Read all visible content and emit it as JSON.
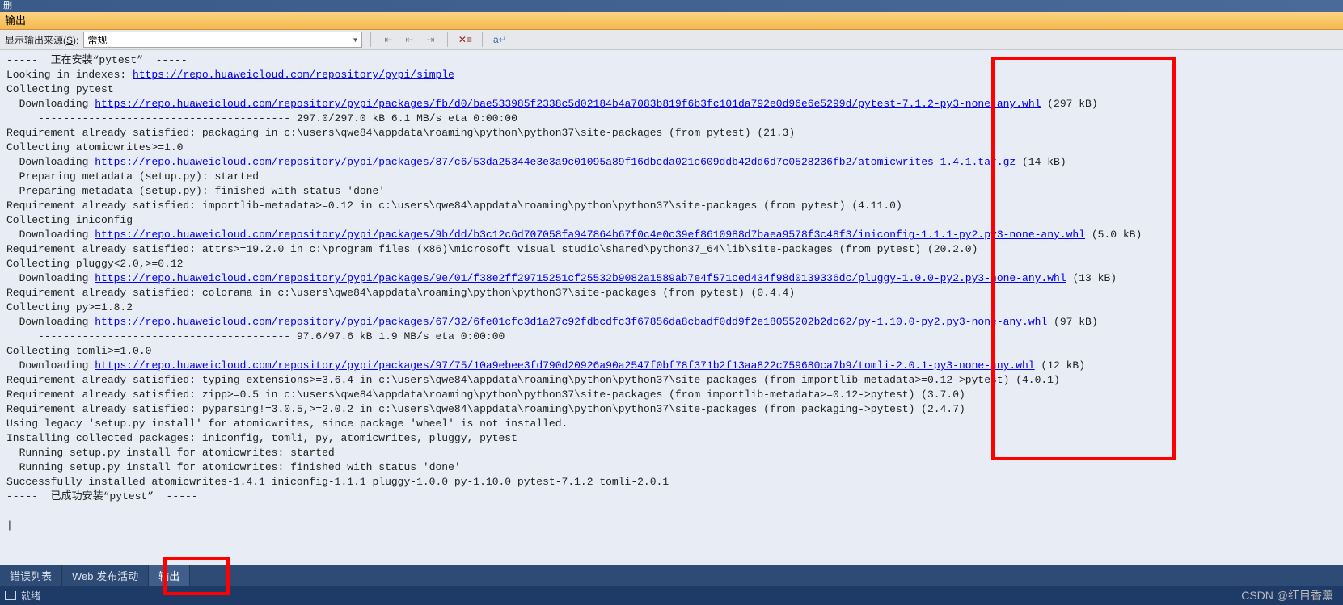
{
  "title_bar": "删",
  "panel_title": "输出",
  "toolbar": {
    "source_label_prefix": "显示输出来源(",
    "source_label_accel": "S",
    "source_label_suffix": "):",
    "source_value": "常规"
  },
  "bottom_tabs": {
    "error_list": "错误列表",
    "web_publish": "Web 发布活动",
    "output": "输出"
  },
  "status_bar": {
    "text": "就绪"
  },
  "watermark": "CSDN @红目香薰",
  "lines": [
    {
      "indent": 0,
      "parts": [
        {
          "t": "text",
          "v": "-----  正在安装“pytest”  -----"
        }
      ]
    },
    {
      "indent": 0,
      "parts": [
        {
          "t": "text",
          "v": "Looking in indexes: "
        },
        {
          "t": "link",
          "v": "https://repo.huaweicloud.com/repository/pypi/simple"
        }
      ]
    },
    {
      "indent": 0,
      "parts": [
        {
          "t": "text",
          "v": "Collecting pytest"
        }
      ]
    },
    {
      "indent": 1,
      "parts": [
        {
          "t": "text",
          "v": "Downloading "
        },
        {
          "t": "link",
          "v": "https://repo.huaweicloud.com/repository/pypi/packages/fb/d0/bae533985f2338c5d02184b4a7083b819f6b3fc101da792e0d96e6e5299d/pytest-7.1.2-py3-none-any.whl"
        },
        {
          "t": "text",
          "v": " (297 kB)"
        }
      ]
    },
    {
      "indent": 2,
      "parts": [
        {
          "t": "text",
          "v": "---------------------------------------- 297.0/297.0 kB 6.1 MB/s eta 0:00:00"
        }
      ]
    },
    {
      "indent": 0,
      "parts": [
        {
          "t": "text",
          "v": "Requirement already satisfied: packaging in c:\\users\\qwe84\\appdata\\roaming\\python\\python37\\site-packages (from pytest) (21.3)"
        }
      ]
    },
    {
      "indent": 0,
      "parts": [
        {
          "t": "text",
          "v": "Collecting atomicwrites>=1.0"
        }
      ]
    },
    {
      "indent": 1,
      "parts": [
        {
          "t": "text",
          "v": "Downloading "
        },
        {
          "t": "link",
          "v": "https://repo.huaweicloud.com/repository/pypi/packages/87/c6/53da25344e3e3a9c01095a89f16dbcda021c609ddb42dd6d7c0528236fb2/atomicwrites-1.4.1.tar.gz"
        },
        {
          "t": "text",
          "v": " (14 kB)"
        }
      ]
    },
    {
      "indent": 1,
      "parts": [
        {
          "t": "text",
          "v": "Preparing metadata (setup.py): started"
        }
      ]
    },
    {
      "indent": 1,
      "parts": [
        {
          "t": "text",
          "v": "Preparing metadata (setup.py): finished with status 'done'"
        }
      ]
    },
    {
      "indent": 0,
      "parts": [
        {
          "t": "text",
          "v": "Requirement already satisfied: importlib-metadata>=0.12 in c:\\users\\qwe84\\appdata\\roaming\\python\\python37\\site-packages (from pytest) (4.11.0)"
        }
      ]
    },
    {
      "indent": 0,
      "parts": [
        {
          "t": "text",
          "v": "Collecting iniconfig"
        }
      ]
    },
    {
      "indent": 1,
      "parts": [
        {
          "t": "text",
          "v": "Downloading "
        },
        {
          "t": "link",
          "v": "https://repo.huaweicloud.com/repository/pypi/packages/9b/dd/b3c12c6d707058fa947864b67f0c4e0c39ef8610988d7baea9578f3c48f3/iniconfig-1.1.1-py2.py3-none-any.whl"
        },
        {
          "t": "text",
          "v": " (5.0 kB)"
        }
      ]
    },
    {
      "indent": 0,
      "parts": [
        {
          "t": "text",
          "v": "Requirement already satisfied: attrs>=19.2.0 in c:\\program files (x86)\\microsoft visual studio\\shared\\python37_64\\lib\\site-packages (from pytest) (20.2.0)"
        }
      ]
    },
    {
      "indent": 0,
      "parts": [
        {
          "t": "text",
          "v": "Collecting pluggy<2.0,>=0.12"
        }
      ]
    },
    {
      "indent": 1,
      "parts": [
        {
          "t": "text",
          "v": "Downloading "
        },
        {
          "t": "link",
          "v": "https://repo.huaweicloud.com/repository/pypi/packages/9e/01/f38e2ff29715251cf25532b9082a1589ab7e4f571ced434f98d0139336dc/pluggy-1.0.0-py2.py3-none-any.whl"
        },
        {
          "t": "text",
          "v": " (13 kB)"
        }
      ]
    },
    {
      "indent": 0,
      "parts": [
        {
          "t": "text",
          "v": "Requirement already satisfied: colorama in c:\\users\\qwe84\\appdata\\roaming\\python\\python37\\site-packages (from pytest) (0.4.4)"
        }
      ]
    },
    {
      "indent": 0,
      "parts": [
        {
          "t": "text",
          "v": "Collecting py>=1.8.2"
        }
      ]
    },
    {
      "indent": 1,
      "parts": [
        {
          "t": "text",
          "v": "Downloading "
        },
        {
          "t": "link",
          "v": "https://repo.huaweicloud.com/repository/pypi/packages/67/32/6fe01cfc3d1a27c92fdbcdfc3f67856da8cbadf0dd9f2e18055202b2dc62/py-1.10.0-py2.py3-none-any.whl"
        },
        {
          "t": "text",
          "v": " (97 kB)"
        }
      ]
    },
    {
      "indent": 2,
      "parts": [
        {
          "t": "text",
          "v": "---------------------------------------- 97.6/97.6 kB 1.9 MB/s eta 0:00:00"
        }
      ]
    },
    {
      "indent": 0,
      "parts": [
        {
          "t": "text",
          "v": "Collecting tomli>=1.0.0"
        }
      ]
    },
    {
      "indent": 1,
      "parts": [
        {
          "t": "text",
          "v": "Downloading "
        },
        {
          "t": "link",
          "v": "https://repo.huaweicloud.com/repository/pypi/packages/97/75/10a9ebee3fd790d20926a90a2547f0bf78f371b2f13aa822c759680ca7b9/tomli-2.0.1-py3-none-any.whl"
        },
        {
          "t": "text",
          "v": " (12 kB)"
        }
      ]
    },
    {
      "indent": 0,
      "parts": [
        {
          "t": "text",
          "v": "Requirement already satisfied: typing-extensions>=3.6.4 in c:\\users\\qwe84\\appdata\\roaming\\python\\python37\\site-packages (from importlib-metadata>=0.12->pytest) (4.0.1)"
        }
      ]
    },
    {
      "indent": 0,
      "parts": [
        {
          "t": "text",
          "v": "Requirement already satisfied: zipp>=0.5 in c:\\users\\qwe84\\appdata\\roaming\\python\\python37\\site-packages (from importlib-metadata>=0.12->pytest) (3.7.0)"
        }
      ]
    },
    {
      "indent": 0,
      "parts": [
        {
          "t": "text",
          "v": "Requirement already satisfied: pyparsing!=3.0.5,>=2.0.2 in c:\\users\\qwe84\\appdata\\roaming\\python\\python37\\site-packages (from packaging->pytest) (2.4.7)"
        }
      ]
    },
    {
      "indent": 0,
      "parts": [
        {
          "t": "text",
          "v": "Using legacy 'setup.py install' for atomicwrites, since package 'wheel' is not installed."
        }
      ]
    },
    {
      "indent": 0,
      "parts": [
        {
          "t": "text",
          "v": "Installing collected packages: iniconfig, tomli, py, atomicwrites, pluggy, pytest"
        }
      ]
    },
    {
      "indent": 1,
      "parts": [
        {
          "t": "text",
          "v": "Running setup.py install for atomicwrites: started"
        }
      ]
    },
    {
      "indent": 1,
      "parts": [
        {
          "t": "text",
          "v": "Running setup.py install for atomicwrites: finished with status 'done'"
        }
      ]
    },
    {
      "indent": 0,
      "parts": [
        {
          "t": "text",
          "v": "Successfully installed atomicwrites-1.4.1 iniconfig-1.1.1 pluggy-1.0.0 py-1.10.0 pytest-7.1.2 tomli-2.0.1"
        }
      ]
    },
    {
      "indent": 0,
      "parts": [
        {
          "t": "text",
          "v": "-----  已成功安装“pytest”  -----"
        }
      ]
    }
  ]
}
